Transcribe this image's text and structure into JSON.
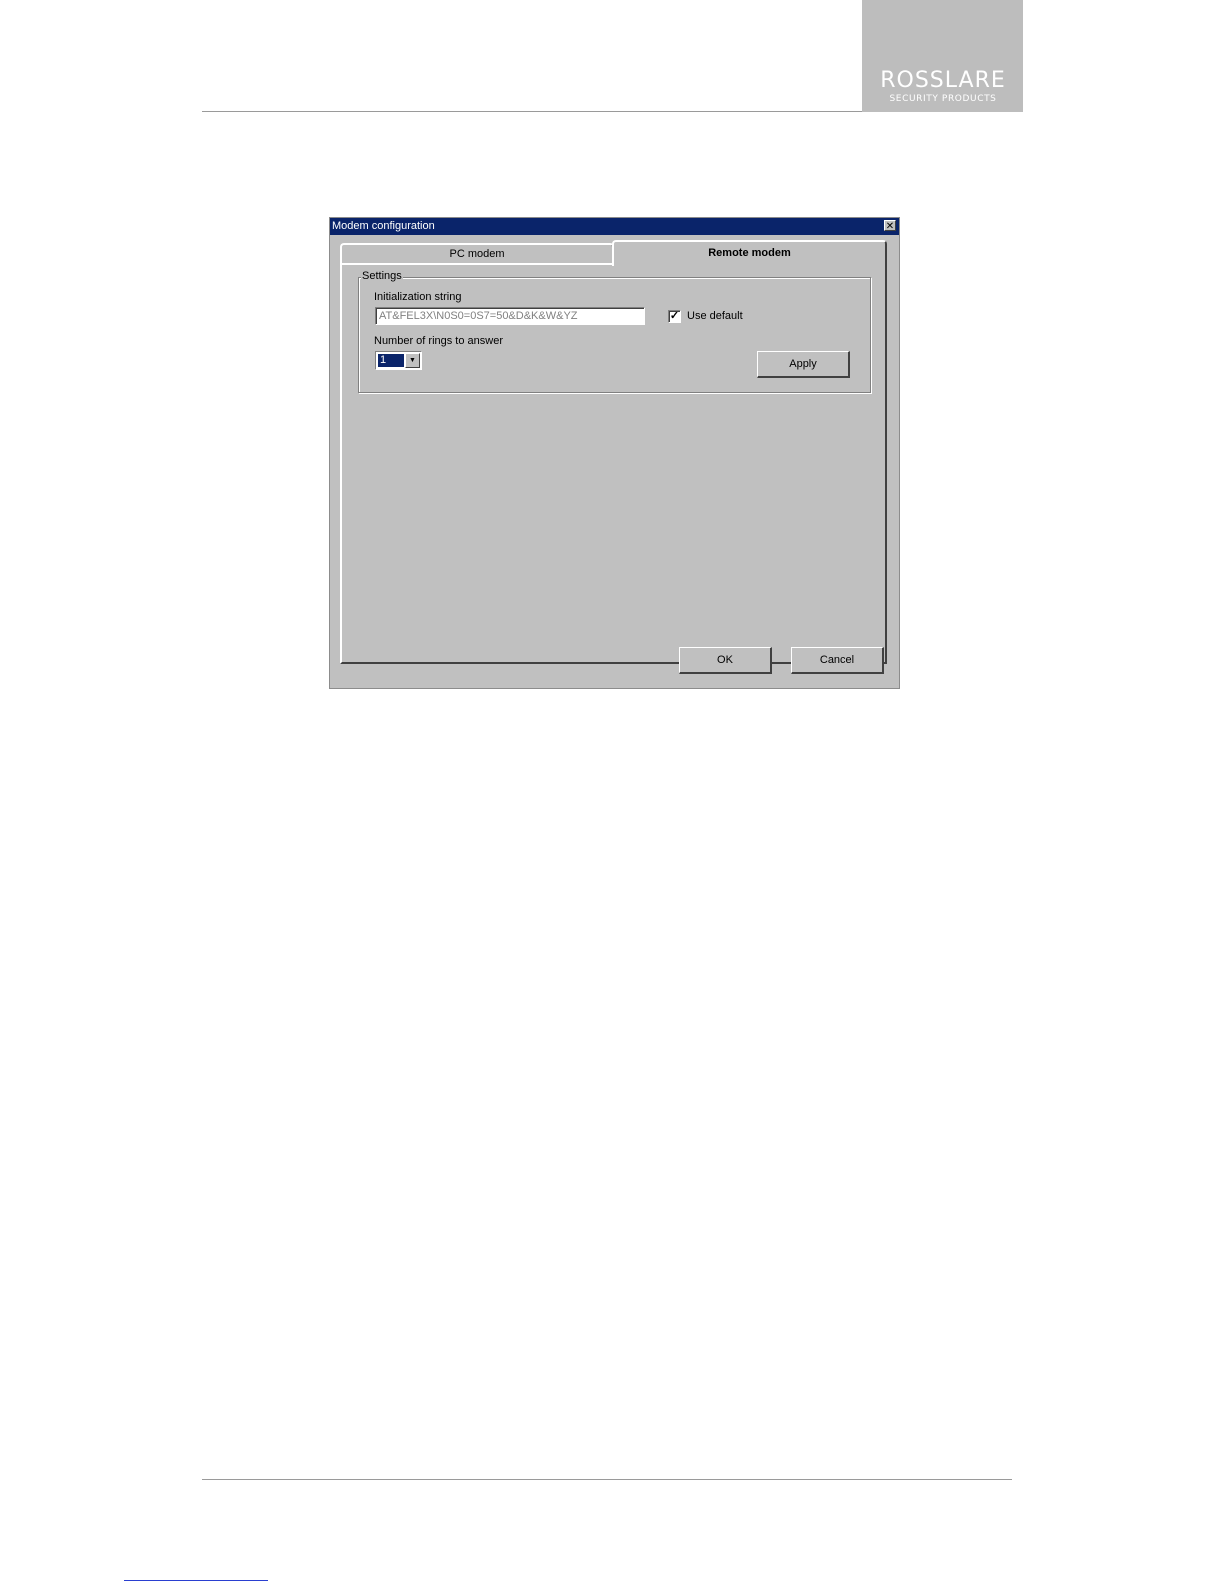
{
  "logo": {
    "brand": "ROSSLARE",
    "tagline": "SECURITY PRODUCTS"
  },
  "dialog": {
    "title": "Modem configuration",
    "close_symbol": "✕",
    "tabs": [
      {
        "label": "PC modem",
        "active": false
      },
      {
        "label": "Remote modem",
        "active": true
      }
    ],
    "settings": {
      "legend": "Settings",
      "init_label": "Initialization string",
      "init_value": "AT&FEL3X\\N0S0=0S7=50&D&K&W&YZ",
      "use_default_label": "Use default",
      "use_default_checked": true,
      "check_mark": "✓",
      "rings_label": "Number of rings to answer",
      "rings_value": "1",
      "dropdown_arrow": "▼",
      "apply_label": "Apply"
    },
    "ok_label": "OK",
    "cancel_label": "Cancel"
  },
  "colors": {
    "titlebar": "#0a246a",
    "face": "#c0c0c0",
    "logo_bg": "#bdbdbd"
  }
}
